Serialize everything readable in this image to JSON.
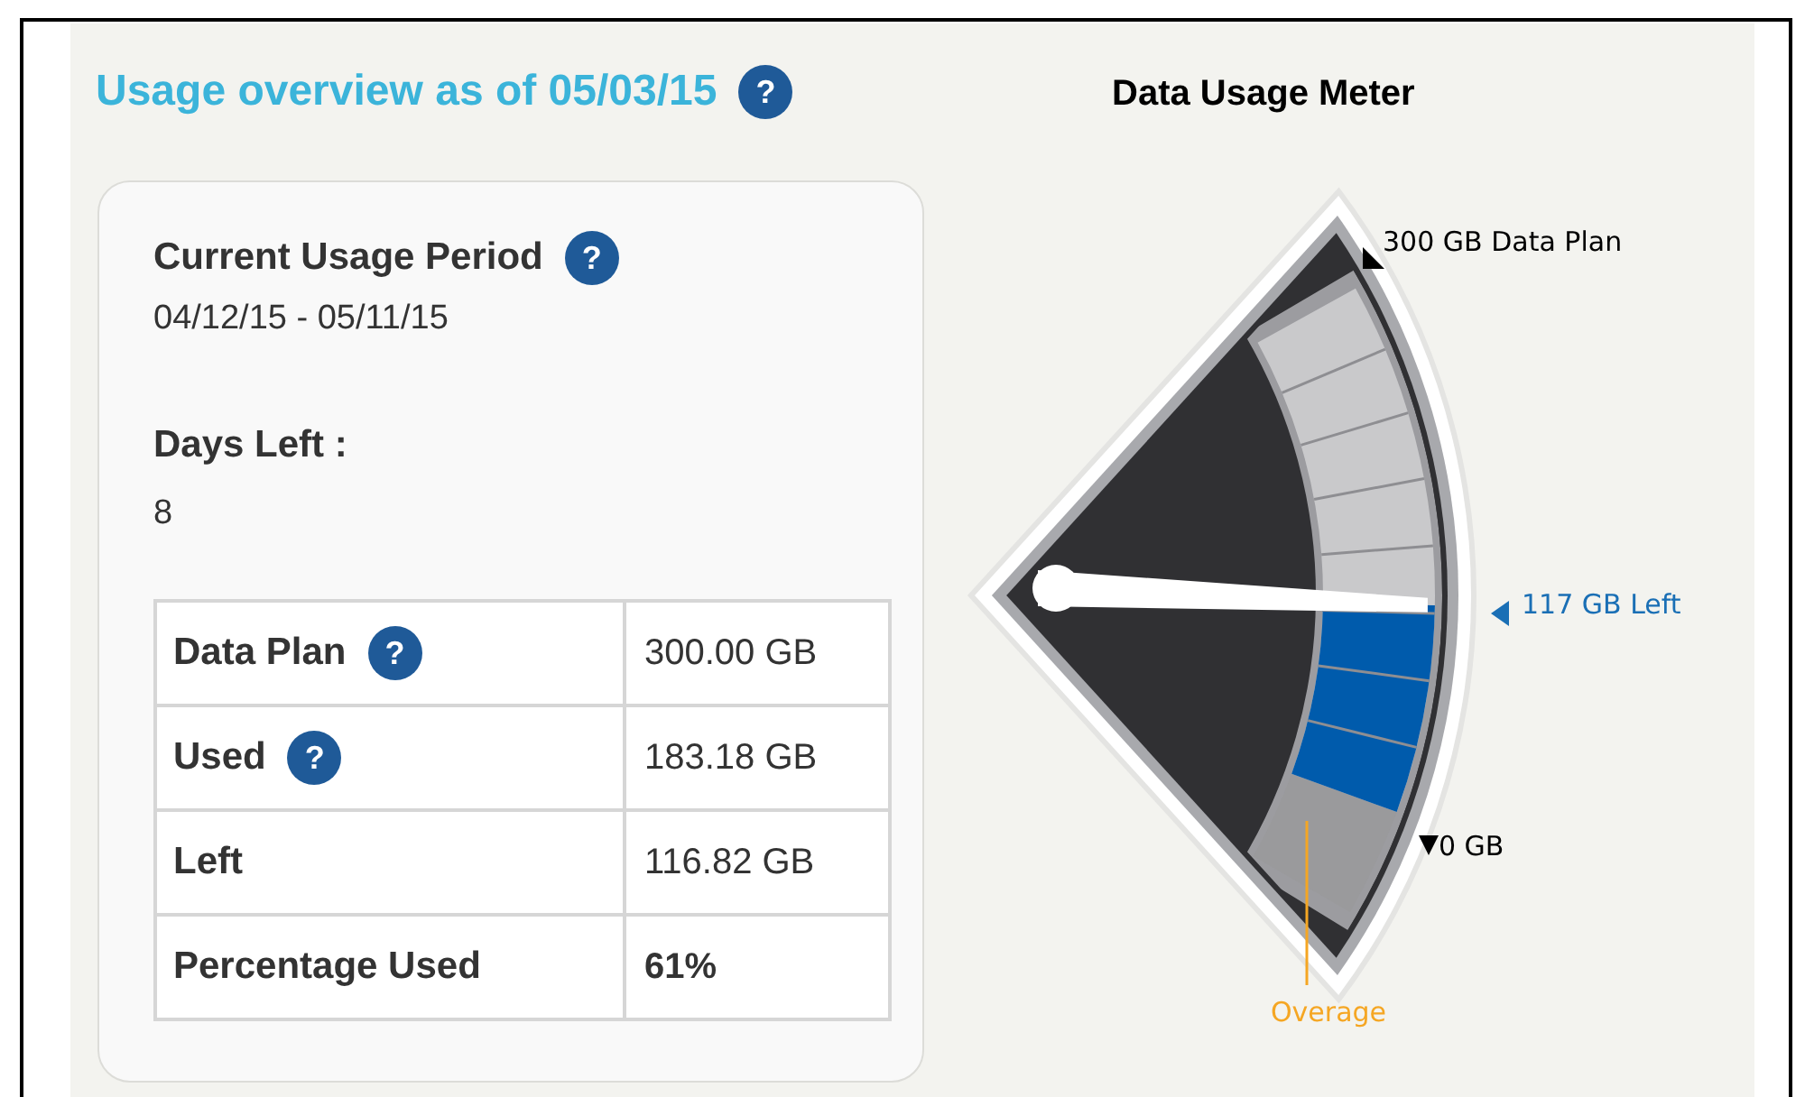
{
  "overview": {
    "title": "Usage overview as of 05/03/15",
    "help": "?"
  },
  "period": {
    "label": "Current Usage Period",
    "help": "?",
    "value": "04/12/15 - 05/11/15"
  },
  "days_left": {
    "label": "Days Left :",
    "value": "8"
  },
  "table": {
    "rows": [
      {
        "label": "Data Plan",
        "help": "?",
        "value": "300.00 GB",
        "bold_value": false
      },
      {
        "label": "Used",
        "help": "?",
        "value": "183.18 GB",
        "bold_value": false
      },
      {
        "label": "Left",
        "value": "116.82 GB",
        "bold_value": false
      },
      {
        "label": "Percentage Used",
        "value": "61%",
        "bold_value": true
      }
    ]
  },
  "meter": {
    "title": "Data Usage Meter",
    "level": 0.39,
    "plan_label": "300 GB Data Plan",
    "left_label": "117 GB Left",
    "zero_label": "0 GB",
    "overage_label": "Overage"
  }
}
